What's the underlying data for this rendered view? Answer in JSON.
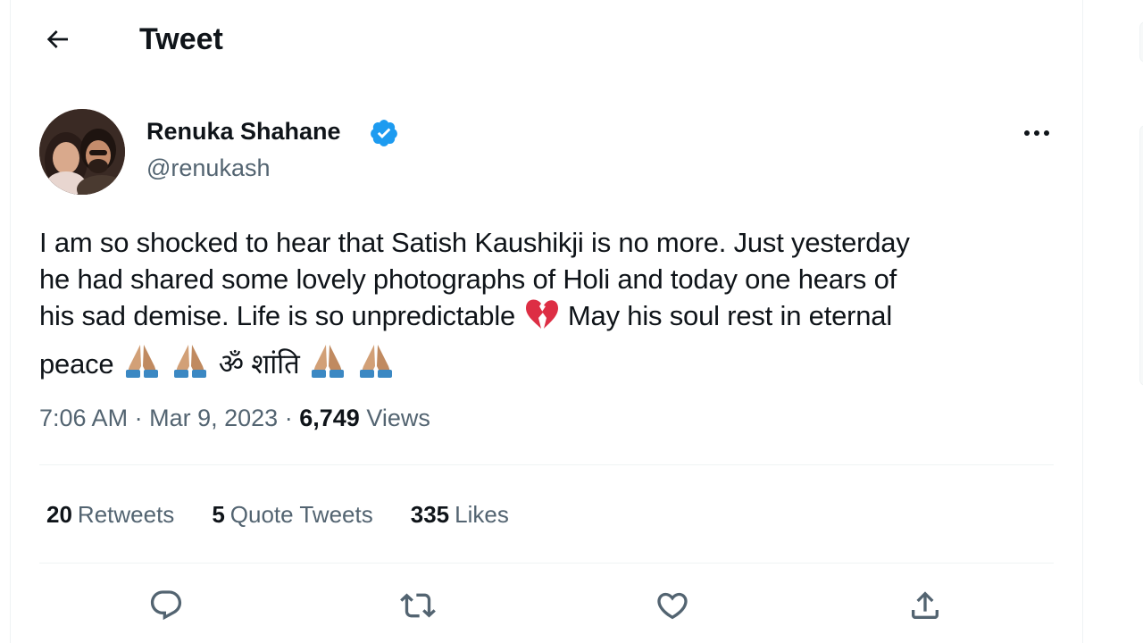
{
  "header": {
    "title": "Tweet",
    "back_icon": "arrow-left-icon"
  },
  "author": {
    "name": "Renuka Shahane",
    "handle": "@renukash",
    "verified_color": "#1d9bf0"
  },
  "tweet": {
    "line1": "I am so shocked to hear that Satish Kaushikji is no more. Just yesterday",
    "line2": "he had shared some lovely photographs of Holi and today one hears of",
    "line3_a": "his sad demise. Life is so unpredictable",
    "line3_b": "May his soul rest in eternal",
    "line4_a": "peace",
    "line4_b": "ॐ शांति",
    "emoji_broken_heart": "broken-heart-emoji",
    "emoji_pray": "folded-hands-emoji"
  },
  "meta": {
    "time": "7:06 AM",
    "separator": "·",
    "date": "Mar 9, 2023",
    "views_count": "6,749",
    "views_label": "Views"
  },
  "stats": {
    "retweets_count": "20",
    "retweets_label": "Retweets",
    "quotes_count": "5",
    "quotes_label": "Quote Tweets",
    "likes_count": "335",
    "likes_label": "Likes"
  },
  "actions": [
    "reply-icon",
    "retweet-icon",
    "like-icon",
    "share-icon"
  ],
  "colors": {
    "text_primary": "#0f1419",
    "text_secondary": "#536471",
    "divider": "#eff3f4",
    "accent": "#1d9bf0"
  }
}
